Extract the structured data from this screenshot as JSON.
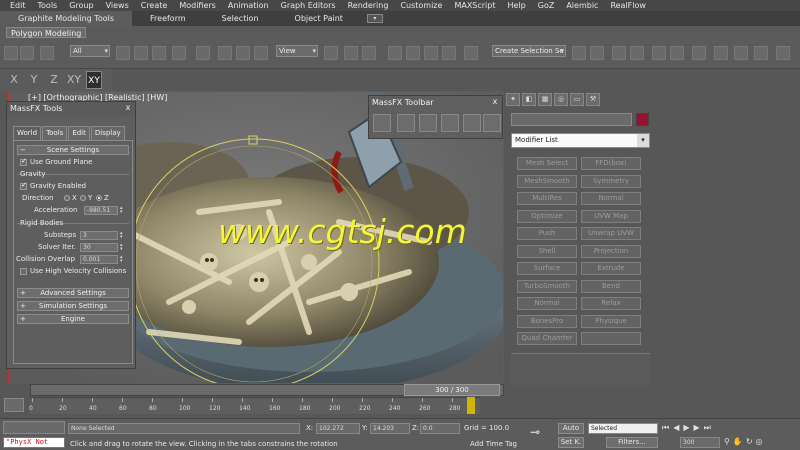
{
  "menu": [
    "Edit",
    "Tools",
    "Group",
    "Views",
    "Create",
    "Modifiers",
    "Animation",
    "Graph Editors",
    "Rendering",
    "Customize",
    "MAXScript",
    "Help",
    "GoZ",
    "Alembic",
    "RealFlow"
  ],
  "ribbon": {
    "tabs": [
      "Graphite Modeling Tools",
      "Freeform",
      "Selection",
      "Object Paint"
    ],
    "subtab": "Polygon Modeling"
  },
  "toolbar": {
    "filter_value": "All",
    "refcoord_value": "View",
    "selection_set_placeholder": "Create Selection Se"
  },
  "axis": [
    "X",
    "Y",
    "Z",
    "XY"
  ],
  "viewport": {
    "label": "[+] [Orthographic] [Realistic] [HW]",
    "watermark": "www.cgtsj.com",
    "border_color": "#c83030"
  },
  "massfx_tools": {
    "title": "MassFX Tools",
    "close": "x",
    "tabs": [
      "World",
      "Tools",
      "Edit",
      "Display"
    ],
    "scene_settings": "Scene Settings",
    "use_ground_plane": "Use Ground Plane",
    "gravity_group": "Gravity",
    "gravity_enabled": "Gravity Enabled",
    "direction_label": "Direction",
    "direction_options": [
      "X",
      "Y",
      "Z"
    ],
    "acceleration_label": "Acceleration",
    "acceleration_value": "-980.51",
    "rigid_bodies_group": "Rigid Bodies",
    "substeps_label": "Substeps",
    "substeps_value": "3",
    "solver_label": "Solver Iter.",
    "solver_value": "30",
    "collision_label": "Collision Overlap",
    "collision_value": "0.001",
    "high_velocity": "Use High Velocity Collisions",
    "advanced_settings": "Advanced Settings",
    "simulation_settings": "Simulation Settings",
    "engine": "Engine"
  },
  "massfx_toolbar": {
    "title": "MassFX Toolbar",
    "close": "x"
  },
  "command_panel": {
    "modifier_list": "Modifier List",
    "object_color": "#9b1030",
    "modifiers": [
      [
        "Mesh Select",
        "FFD(box)"
      ],
      [
        "MeshSmooth",
        "Symmetry"
      ],
      [
        "MultiRes",
        "Normal"
      ],
      [
        "Optimize",
        "UVW Map"
      ],
      [
        "Push",
        "Unwrap UVW"
      ],
      [
        "Shell",
        "Projection"
      ],
      [
        "Surface",
        "Extrude"
      ],
      [
        "TurboSmooth",
        "Bend"
      ],
      [
        "Normal",
        "Relax"
      ],
      [
        "BonesPro",
        "Physique"
      ],
      [
        "Quad Chamfer",
        ""
      ]
    ]
  },
  "timeline": {
    "frame_label": "300 / 300",
    "ticks": [
      "0",
      "20",
      "40",
      "60",
      "80",
      "100",
      "120",
      "140",
      "160",
      "180",
      "200",
      "220",
      "240",
      "260",
      "280"
    ]
  },
  "status": {
    "script_text": "\"PhysX Not",
    "selection": "None Selected",
    "prompt": "Click and drag to rotate the view.  Clicking in the tabs constrains the rotation",
    "x_label": "X:",
    "x_value": "102.272",
    "y_label": "Y:",
    "y_value": "14.203",
    "z_label": "Z:",
    "z_value": "0.0",
    "grid": "Grid = 100.0",
    "add_time_tag": "Add Time Tag",
    "auto": "Auto",
    "set_key": "Set K.",
    "selected_value": "Selected",
    "filters": "Filters...",
    "frame_value": "300"
  }
}
